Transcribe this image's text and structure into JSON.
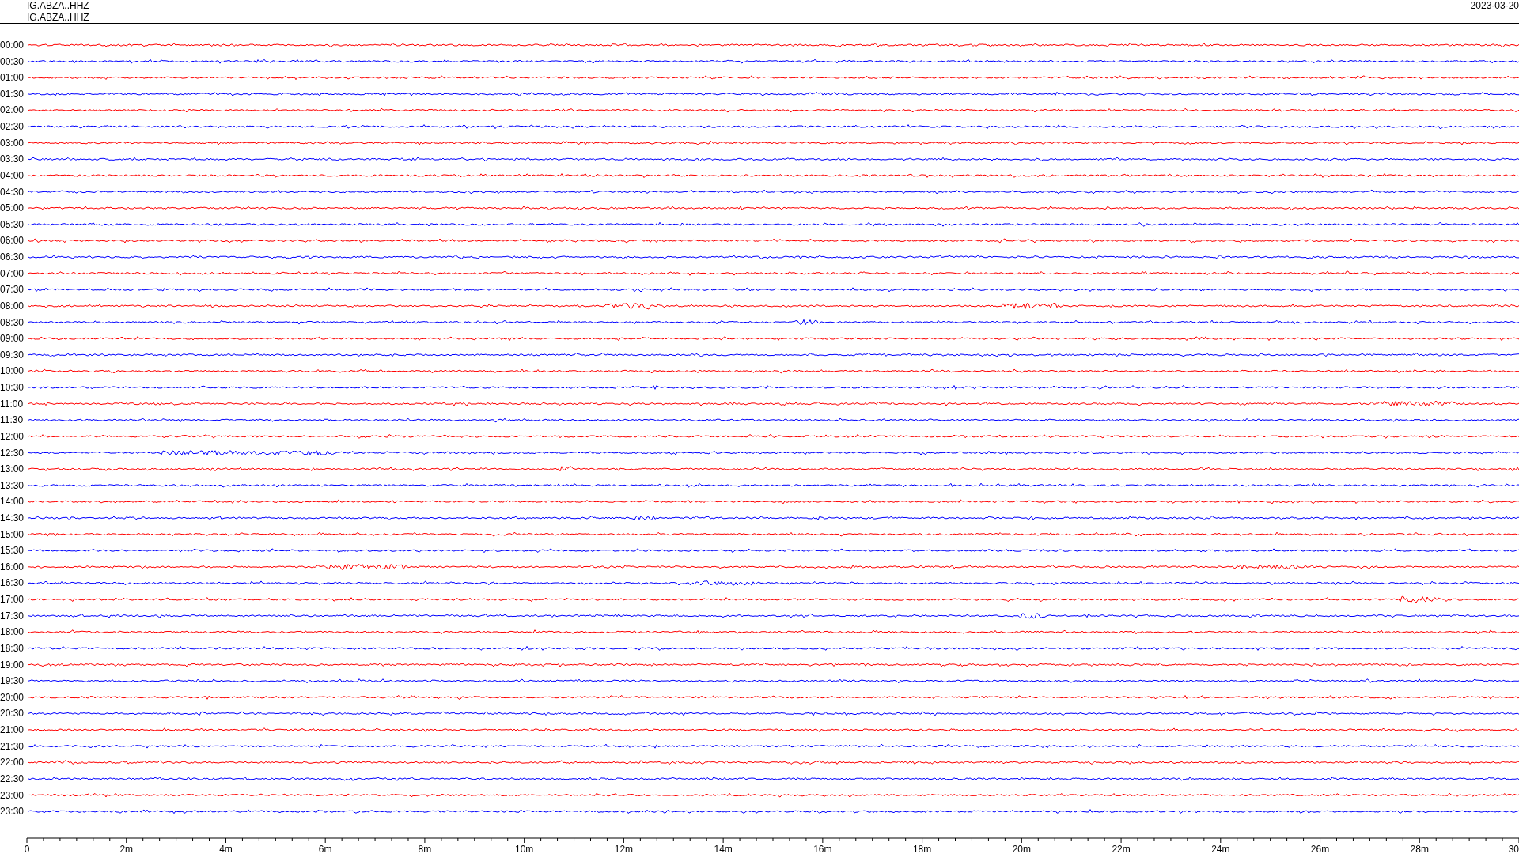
{
  "header": {
    "titles": [
      "IG.ABZA..HHZ",
      "IG.ABZA..HHZ"
    ],
    "date": "2023-03-20"
  },
  "rows": [
    {
      "label": "00:00",
      "color": "#ff0000"
    },
    {
      "label": "00:30",
      "color": "#0000ff"
    },
    {
      "label": "01:00",
      "color": "#ff0000"
    },
    {
      "label": "01:30",
      "color": "#0000ff"
    },
    {
      "label": "02:00",
      "color": "#ff0000"
    },
    {
      "label": "02:30",
      "color": "#0000ff"
    },
    {
      "label": "03:00",
      "color": "#ff0000"
    },
    {
      "label": "03:30",
      "color": "#0000ff"
    },
    {
      "label": "04:00",
      "color": "#ff0000"
    },
    {
      "label": "04:30",
      "color": "#0000ff"
    },
    {
      "label": "05:00",
      "color": "#ff0000"
    },
    {
      "label": "05:30",
      "color": "#0000ff"
    },
    {
      "label": "06:00",
      "color": "#ff0000"
    },
    {
      "label": "06:30",
      "color": "#0000ff"
    },
    {
      "label": "07:00",
      "color": "#ff0000"
    },
    {
      "label": "07:30",
      "color": "#0000ff"
    },
    {
      "label": "08:00",
      "color": "#ff0000"
    },
    {
      "label": "08:30",
      "color": "#0000ff"
    },
    {
      "label": "09:00",
      "color": "#ff0000"
    },
    {
      "label": "09:30",
      "color": "#0000ff"
    },
    {
      "label": "10:00",
      "color": "#ff0000"
    },
    {
      "label": "10:30",
      "color": "#0000ff"
    },
    {
      "label": "11:00",
      "color": "#ff0000"
    },
    {
      "label": "11:30",
      "color": "#0000ff"
    },
    {
      "label": "12:00",
      "color": "#ff0000"
    },
    {
      "label": "12:30",
      "color": "#0000ff"
    },
    {
      "label": "13:00",
      "color": "#ff0000"
    },
    {
      "label": "13:30",
      "color": "#0000ff"
    },
    {
      "label": "14:00",
      "color": "#ff0000"
    },
    {
      "label": "14:30",
      "color": "#0000ff"
    },
    {
      "label": "15:00",
      "color": "#ff0000"
    },
    {
      "label": "15:30",
      "color": "#0000ff"
    },
    {
      "label": "16:00",
      "color": "#ff0000"
    },
    {
      "label": "16:30",
      "color": "#0000ff"
    },
    {
      "label": "17:00",
      "color": "#ff0000"
    },
    {
      "label": "17:30",
      "color": "#0000ff"
    },
    {
      "label": "18:00",
      "color": "#ff0000"
    },
    {
      "label": "18:30",
      "color": "#0000ff"
    },
    {
      "label": "19:00",
      "color": "#ff0000"
    },
    {
      "label": "19:30",
      "color": "#0000ff"
    },
    {
      "label": "20:00",
      "color": "#ff0000"
    },
    {
      "label": "20:30",
      "color": "#0000ff"
    },
    {
      "label": "21:00",
      "color": "#ff0000"
    },
    {
      "label": "21:30",
      "color": "#0000ff"
    },
    {
      "label": "22:00",
      "color": "#ff0000"
    },
    {
      "label": "22:30",
      "color": "#0000ff"
    },
    {
      "label": "23:00",
      "color": "#ff0000"
    },
    {
      "label": "23:30",
      "color": "#0000ff"
    }
  ],
  "x_axis": {
    "tick_labels": [
      "0",
      "2m",
      "4m",
      "6m",
      "8m",
      "10m",
      "12m",
      "14m",
      "16m",
      "18m",
      "20m",
      "22m",
      "24m",
      "26m",
      "28m",
      "30"
    ]
  }
}
